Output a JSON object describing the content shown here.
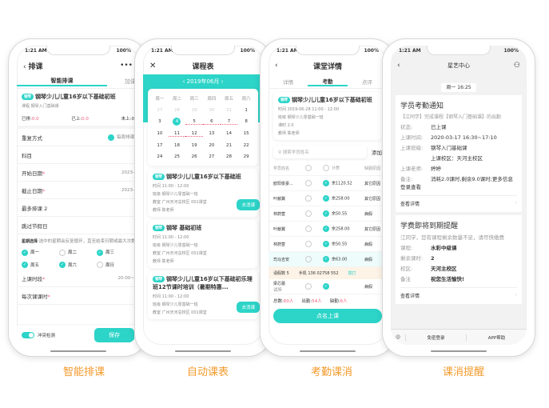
{
  "status_time": "1:21 AM",
  "battery": "100%",
  "phone1": {
    "back": "排课",
    "more": "•••",
    "tabs": [
      "智能排课",
      "加课"
    ],
    "course_tag": "钢琴",
    "course_title": "钢琴少儿儿童16岁以下基础初班",
    "course_label": "课程",
    "course_name": "钢琴入门基础课",
    "course_right": "选择",
    "stats": [
      {
        "label": "已排:",
        "value": "0.0"
      },
      {
        "label": "已上:",
        "value": "0.0"
      },
      {
        "label": "未上:",
        "value": "0"
      }
    ],
    "repeat_label": "重复方式",
    "repeat_option": "每周排课",
    "subject": "科目",
    "start_label": "开始日期",
    "start_value": "2023-",
    "end_label": "截止日期",
    "end_value": "2023-",
    "max_label": "最多排课 2",
    "skip_label": "跳过节假日",
    "week_label": "星期选择",
    "week_hint": "选中的星期会反复循环，直至结束日期或最大次数",
    "days": [
      {
        "d": "周一",
        "on": true
      },
      {
        "d": "周二",
        "on": false
      },
      {
        "d": "周三",
        "on": true
      },
      {
        "d": "周五",
        "on": true
      },
      {
        "d": "周六",
        "on": true
      },
      {
        "d": "周日",
        "on": false
      }
    ],
    "time_label": "上课时段",
    "time_value": "20:00~",
    "each_label": "每次课课时",
    "conflict": "冲突检测",
    "save": "保存"
  },
  "phone2": {
    "title": "课程表",
    "month": "2019年06月",
    "weekdays": [
      "周一",
      "周二",
      "周三",
      "周四",
      "周五",
      "周六"
    ],
    "dates": [
      "27",
      "28",
      "29",
      "30",
      "31",
      "1",
      "3",
      "4",
      "5",
      "6",
      "7",
      "8",
      "10",
      "11",
      "12",
      "13",
      "14",
      "15",
      "17",
      "18",
      "19",
      "20",
      "21",
      "22",
      "24",
      "25",
      "26",
      "27",
      "28",
      "29"
    ],
    "selected": "4",
    "marked": [
      "4",
      "5",
      "6",
      "7",
      "11",
      "12"
    ],
    "lessons": [
      {
        "tag": "钢琴",
        "title": "钢琴少儿儿童16岁以下基础班",
        "time": "时间 11:00 - 12:00",
        "cls": "班级 钢琴少儿零基础一班",
        "room": "教室 广州天河总校区  001课堂",
        "teacher": "教师 陈老师",
        "btn": "去消课"
      },
      {
        "tag": "钢琴",
        "title": "钢琴 基础初班",
        "time": "时间 11:00 - 12:00",
        "cls": "班级 钢琴少儿零基础一班",
        "room": "教室 广州天河总校区  001课堂",
        "teacher": "教师 陈老师"
      },
      {
        "tag": "钢琴",
        "title": "钢琴少儿儿童16岁以下基础初乐理班12节课时培训（暑期特惠...",
        "time": "时间 11:00 - 12:00",
        "cls": "班级 钢琴少儿零基础一班",
        "room": "教室 广州天河总校区  001课堂",
        "btn": "去消课"
      }
    ]
  },
  "phone3": {
    "title": "课堂详情",
    "tabs": [
      "详情",
      "考勤",
      "点评"
    ],
    "tag": "钢琴",
    "course": "钢琴少儿儿童16岁以下基础初班",
    "time": "时间 2019-06-28 11:00 - 12:00",
    "cls": "班级 钢琴少儿零基础一班",
    "hours": "课时 2.0",
    "teacher": "教师 陈老师",
    "search_placeholder": "搜索学员姓名",
    "add": "添加",
    "cols": [
      "学员姓名",
      "出勤",
      "计费",
      "缺勤原因"
    ],
    "students": [
      {
        "n": "欧阳俊豪...",
        "b": "余1120.52",
        "r": "其它原因"
      },
      {
        "n": "叶献翼",
        "b": "余258.00",
        "r": "其它原因"
      },
      {
        "n": "林蔚萱",
        "b": "余50.55",
        "r": "病假"
      },
      {
        "n": "叶献翼",
        "b": "余258.00",
        "r": "其它原因"
      },
      {
        "n": "林蔚萱",
        "b": "余50.55",
        "r": "病假"
      },
      {
        "n": "司马吉安",
        "b": "余63.00",
        "r": "病假"
      }
    ],
    "leave": "请假数 5",
    "phone": "手机 136 02758 552",
    "call": "拨打",
    "trial_name": "梁芯蕾",
    "trial_tag": "试听",
    "trial_reason": "病假",
    "totals": [
      {
        "l": "总数:",
        "v": "60人"
      },
      {
        "l": "出勤:",
        "v": "54人"
      },
      {
        "l": "缺勤:",
        "v": "6人"
      }
    ],
    "submit": "点名上课"
  },
  "phone4": {
    "title": "星艺中心",
    "time": "周一 16:25",
    "n1": {
      "title": "学员考勤通知",
      "intro": "【江同学】完成课程【钢琴入门基础课】的出勤",
      "rows": [
        {
          "l": "状态:",
          "v": "已上课"
        },
        {
          "l": "上课时间:",
          "v": "2020-03-17 16:30~17:10"
        },
        {
          "l": "上课班级:",
          "v": "钢琴入门基础课"
        },
        {
          "l": "",
          "v": "上课校区：天河主校区"
        },
        {
          "l": "上课老师:",
          "v": "婷婷"
        },
        {
          "l": "备注:",
          "v": "消耗2.0课时,剩余9.0课时;更多信息登录查看"
        }
      ],
      "detail": "查看详情"
    },
    "n2": {
      "title": "学费即将到期提醒",
      "intro": "江同学，您有课程剩余数量不足，请尽快缴费",
      "rows": [
        {
          "l": "课程:",
          "v": "水彩中级课"
        },
        {
          "l": "剩余课时:",
          "v": "2"
        },
        {
          "l": "校区:",
          "v": "天河主校区"
        },
        {
          "l": "备注",
          "v": "祝您生活愉快!"
        }
      ],
      "detail": "查看详情"
    },
    "bottom": [
      "免密登录",
      "APP帮助"
    ]
  },
  "captions": [
    "智能排课",
    "自动课表",
    "考勤课消",
    "课消提醒"
  ],
  "colors": {
    "accent": "#2dd4c8",
    "caption": "#f39a2b",
    "alert": "#f25a7a"
  }
}
